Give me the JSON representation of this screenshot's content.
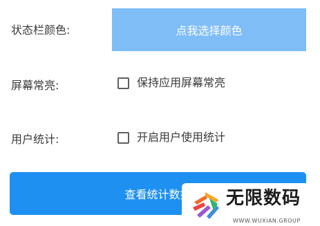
{
  "settings": {
    "statusbar_color_label": "状态栏颜色:",
    "statusbar_color_button": "点我选择颜色",
    "screen_on_label": "屏幕常亮:",
    "screen_on_checkbox": "保持应用屏幕常亮",
    "screen_on_checked": false,
    "user_stats_label": "用户统计:",
    "user_stats_checkbox": "开启用户使用统计",
    "user_stats_checked": false,
    "view_stats_button": "查看统计数据"
  },
  "watermark": {
    "title": "无限数码",
    "subtitle": "WWW.WUXIAN.GROUP"
  },
  "colors": {
    "color_button_bg": "#7fbdf7",
    "primary_button_bg": "#1e90f2"
  }
}
